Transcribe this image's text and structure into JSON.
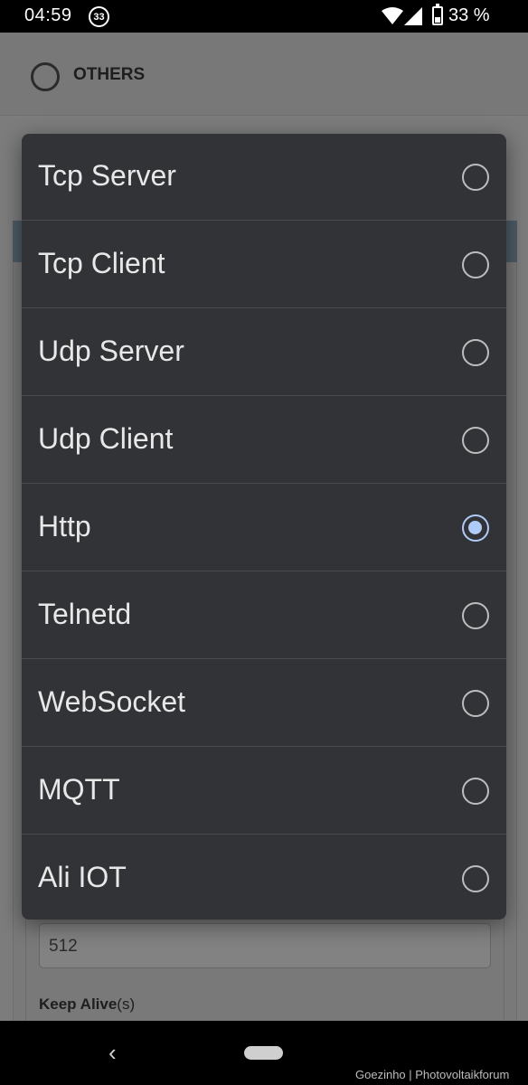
{
  "status_bar": {
    "time": "04:59",
    "notification_count": "33",
    "battery_percent": "33 %"
  },
  "background": {
    "header_title": "OTHERS",
    "field_value": "512",
    "keep_alive_label": "Keep Alive",
    "keep_alive_unit": "(s)"
  },
  "dialog": {
    "options": [
      {
        "label": "Tcp Server",
        "selected": false
      },
      {
        "label": "Tcp Client",
        "selected": false
      },
      {
        "label": "Udp Server",
        "selected": false
      },
      {
        "label": "Udp Client",
        "selected": false
      },
      {
        "label": "Http",
        "selected": true
      },
      {
        "label": "Telnetd",
        "selected": false
      },
      {
        "label": "WebSocket",
        "selected": false
      },
      {
        "label": "MQTT",
        "selected": false
      },
      {
        "label": "Ali IOT",
        "selected": false
      }
    ]
  },
  "nav": {
    "back_glyph": "‹",
    "watermark": "Goezinho | Photovoltaikforum"
  },
  "colors": {
    "dialog_bg": "#323336",
    "radio_selected": "#aecbfa",
    "radio_unselected": "#bdbdbd"
  }
}
